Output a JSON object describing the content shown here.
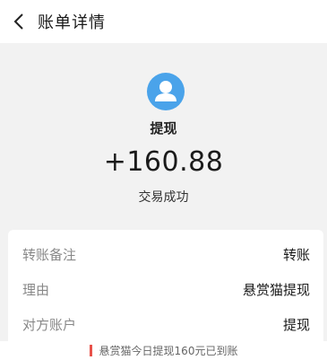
{
  "header": {
    "title": "账单详情",
    "back_icon": "chevron-left-icon"
  },
  "summary": {
    "avatar_icon": "user-avatar-icon",
    "avatar_color": "#4aa3ea",
    "type": "提现",
    "amount": "+160.88",
    "status": "交易成功"
  },
  "details": [
    {
      "label": "转账备注",
      "value": "转账"
    },
    {
      "label": "理由",
      "value": "悬赏猫提现"
    },
    {
      "label": "对方账户",
      "value": "提现"
    }
  ],
  "caption": {
    "text": "悬赏猫今日提现160元已到账",
    "marker_color": "#e8524a"
  }
}
